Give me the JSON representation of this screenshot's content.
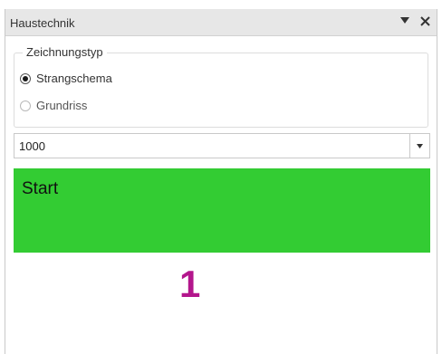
{
  "panel": {
    "title": "Haustechnik",
    "controls": {
      "dropdown_icon": "triangle-down-icon",
      "close_icon": "close-icon"
    }
  },
  "drawing_type": {
    "legend": "Zeichnungstyp",
    "options": [
      {
        "label": "Strangschema",
        "selected": true
      },
      {
        "label": "Grundriss",
        "selected": false
      }
    ]
  },
  "scale_select": {
    "value": "1000",
    "arrow_icon": "chevron-down-icon"
  },
  "start_button": {
    "label": "Start",
    "color": "#33cc33"
  },
  "annotation": {
    "label": "1",
    "color": "#b3168c"
  }
}
